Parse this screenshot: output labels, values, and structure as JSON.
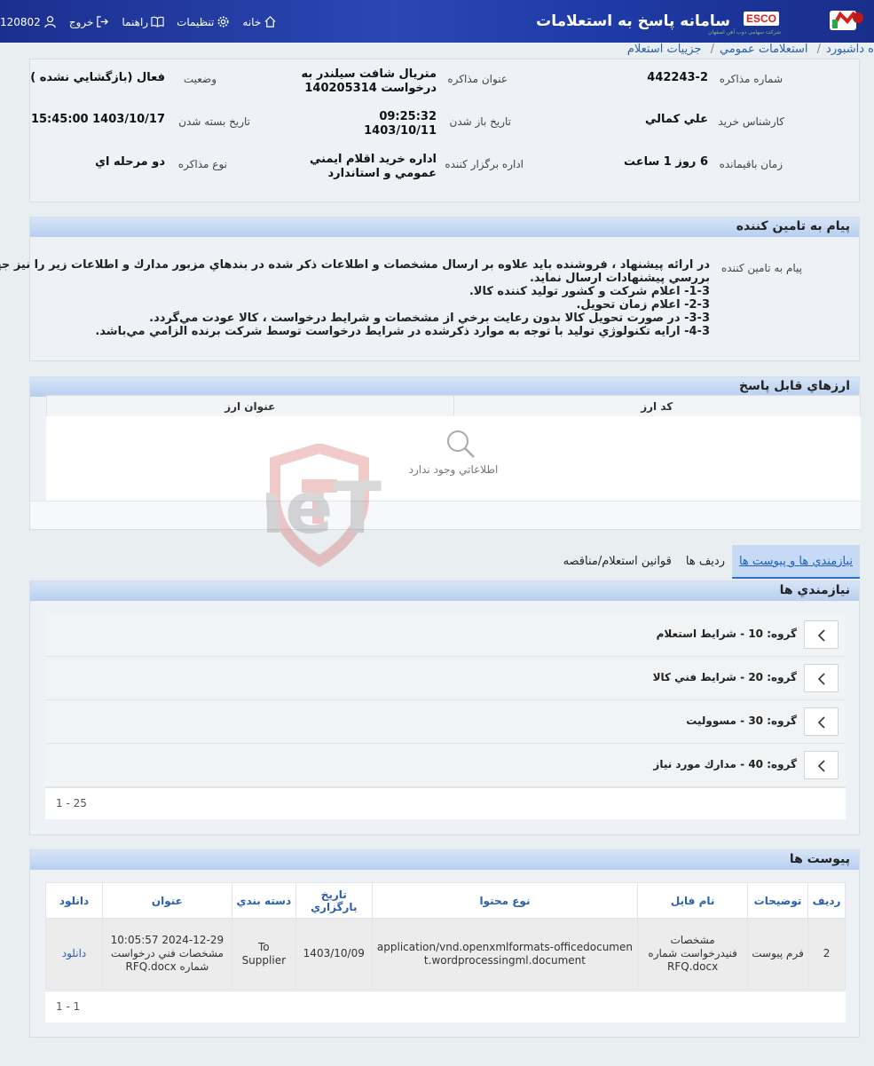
{
  "header": {
    "title": "سامانه پاسخ به استعلامات",
    "brand": "ESCO",
    "brand_sub": "شرکت سهامی ذوب آهن اصفهان",
    "user_id": "120802",
    "exit_label": "خروج",
    "guide_label": "راهنما",
    "settings_label": "تنظیمات",
    "home_label": "خانه"
  },
  "breadcrumb": [
    "ه داشبورد",
    "استعلامات عمومي",
    "جزييات استعلام"
  ],
  "details": {
    "number_label": "شماره مذاكره",
    "number_value": "442243-2",
    "subject_label": "عنوان مذاكره",
    "subject_value_1": "متريال شافت سيلندر به",
    "subject_value_2": "درخواست 140205314",
    "status_label": "وضعيت",
    "status_value": "فعال (بازگشايي نشده )",
    "expert_label": "كارشناس خريد",
    "expert_value": "علي كمالي",
    "open_date_label": "تاريخ باز شدن",
    "open_date_value_1": "09:25:32",
    "open_date_value_2": "1403/10/11",
    "close_date_label": "تاريخ بسته شدن",
    "close_date_value": "1403/10/17 15:45:00",
    "remaining_label": "زمان باقيمانده",
    "remaining_value": "6 روز 1 ساعت",
    "org_label": "اداره برگزار كننده",
    "org_value_1": "اداره خريد اقلام ايمني",
    "org_value_2": "عمومي و استاندارد",
    "type_label": "نوع مذاكره",
    "type_value": "دو مرحله اي"
  },
  "message": {
    "title": "پيام به تامين كننده",
    "label": "پيام به تامين كننده",
    "lines": [
      "در ارائه پيشنهاد ، فروشنده بايد علاوه بر ارسال مشخصات و اطلاعات ذكر شده در بندهاي مزبور مدارك و اطلاعات زير را نيز جهت",
      "بررسي پيشنهادات ارسال نمايد.",
      "1-3- اعلام شركت و كشور توليد كننده كالا.",
      "2-3- اعلام زمان تحويل.",
      "3-3- در صورت تحويل كالا بدون رعايت برخي از مشخصات و شرايط درخواست ، كالا عودت مي‌گردد.",
      "4-3- ارايه تكنولوژي توليد با توجه به موارد ذكرشده در شرايط درخواست توسط شركت برنده الزامي مي‌باشد."
    ]
  },
  "currencies": {
    "title": "ارزهاي قابل پاسخ",
    "col_code": "كد ارز",
    "col_title": "عنوان ارز",
    "empty": "اطلاعاتي وجود ندارد"
  },
  "tabs": [
    "نيازمندي ها و پيوست ها",
    "رديف ها",
    "قوانين استعلام/مناقصه"
  ],
  "requirements": {
    "title": "نيازمندي ها",
    "groups": [
      "گروه: 10 - شرايط استعلام",
      "گروه: 20 - شرايط فني كالا",
      "گروه: 30 - مسووليت",
      "گروه: 40 - مدارك مورد نياز"
    ],
    "pager": "1 - 25"
  },
  "attachments": {
    "title": "پيوست ها",
    "columns": [
      "رديف",
      "توضيحات",
      "نام فايل",
      "نوع محتوا",
      "تاريخ بارگزاري",
      "دسته بندي",
      "عنوان",
      "دانلود"
    ],
    "rows": [
      {
        "row": "2",
        "desc": "فرم پيوست",
        "file": "مشخصات فنيدرخواست شماره RFQ.docx",
        "content_type": "application/vnd.openxmlformats-officedocument.wordprocessingml.document",
        "date": "1403/10/09",
        "category": "To Supplier",
        "title": "2024-12-29 10:05:57 مشخصات فني درخواست شماره RFQ.docx",
        "download": "دانلود"
      }
    ],
    "pager": "1 - 1"
  },
  "watermark": "AriaTender.neT",
  "colors": {
    "header_bg": "#1e3aa5",
    "panel_head": "#c3d7f3",
    "link": "#2a60b0",
    "active_tab": "#c7daf5"
  }
}
